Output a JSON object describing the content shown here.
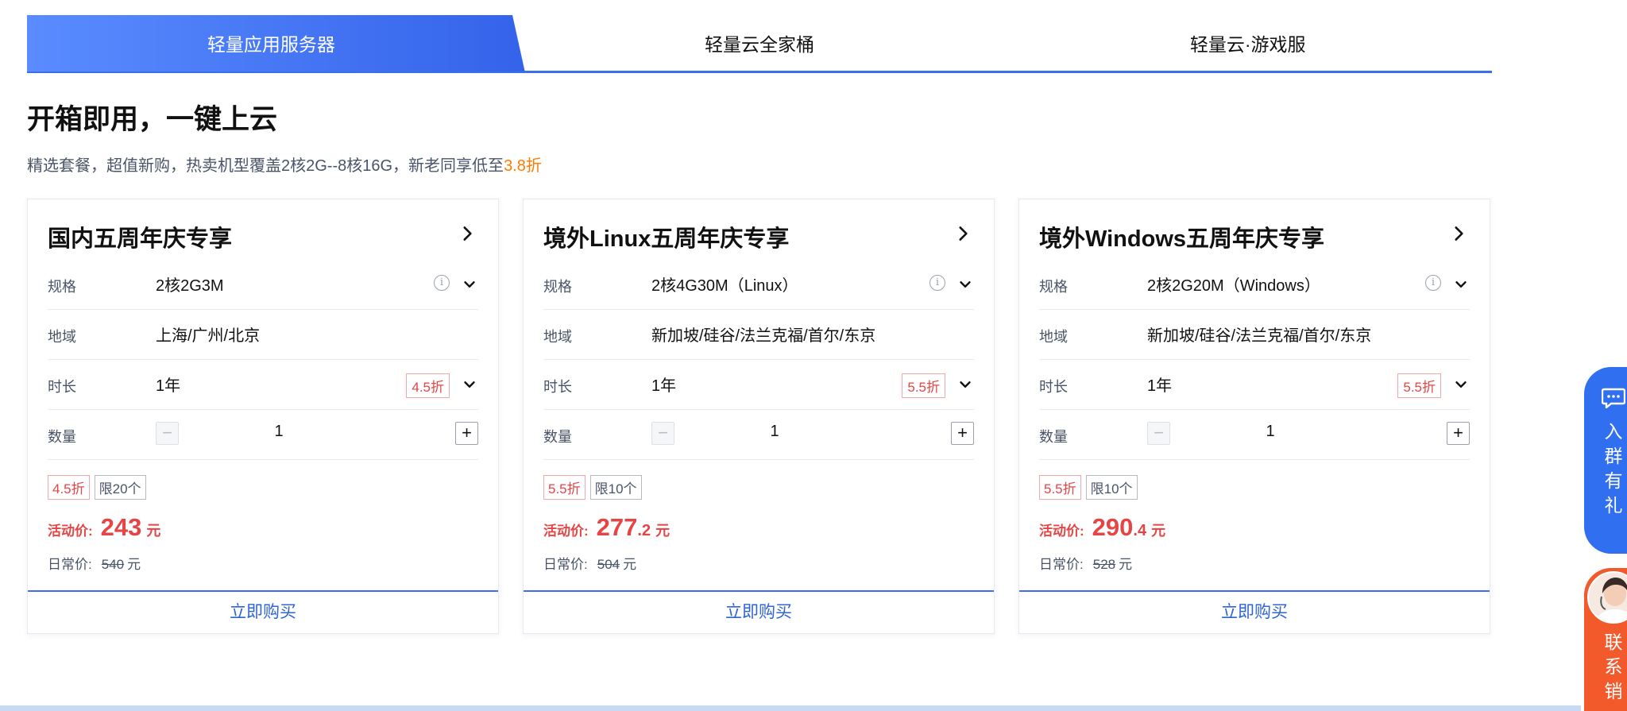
{
  "tabs": [
    {
      "label": "轻量应用服务器",
      "active": true
    },
    {
      "label": "轻量云全家桶",
      "active": false
    },
    {
      "label": "轻量云·游戏服",
      "active": false
    }
  ],
  "headline": "开箱即用，一键上云",
  "subline": {
    "text": "精选套餐，超值新购，热卖机型覆盖2核2G--8核16G，新老同享低至",
    "accent": "3.8折"
  },
  "labels": {
    "spec": "规格",
    "region": "地域",
    "duration": "时长",
    "quantity": "数量",
    "activity_price": "活动价:",
    "regular_price": "日常价:",
    "unit": "元",
    "buy": "立即购买",
    "minus": "−",
    "plus": "+"
  },
  "cards": [
    {
      "title": "国内五周年庆专享",
      "spec": "2核2G3M",
      "region": "上海/广州/北京",
      "duration": "1年",
      "duration_discount": "4.5折",
      "quantity": "1",
      "tag_discount": "4.5折",
      "tag_limit": "限20个",
      "price_int": "243",
      "price_dec": "",
      "orig_price": "540"
    },
    {
      "title": "境外Linux五周年庆专享",
      "spec": "2核4G30M（Linux）",
      "region": "新加坡/硅谷/法兰克福/首尔/东京",
      "duration": "1年",
      "duration_discount": "5.5折",
      "quantity": "1",
      "tag_discount": "5.5折",
      "tag_limit": "限10个",
      "price_int": "277",
      "price_dec": ".2",
      "orig_price": "504"
    },
    {
      "title": "境外Windows五周年庆专享",
      "spec": "2核2G20M（Windows）",
      "region": "新加坡/硅谷/法兰克福/首尔/东京",
      "duration": "1年",
      "duration_discount": "5.5折",
      "quantity": "1",
      "tag_discount": "5.5折",
      "tag_limit": "限10个",
      "price_int": "290",
      "price_dec": ".4",
      "orig_price": "528"
    }
  ],
  "float": {
    "group_text": "入群有礼",
    "consult_text": "联系销"
  },
  "colors": {
    "brand_blue": "#3b6fe6",
    "price_red": "#e54545",
    "accent_orange": "#ff7a00"
  }
}
